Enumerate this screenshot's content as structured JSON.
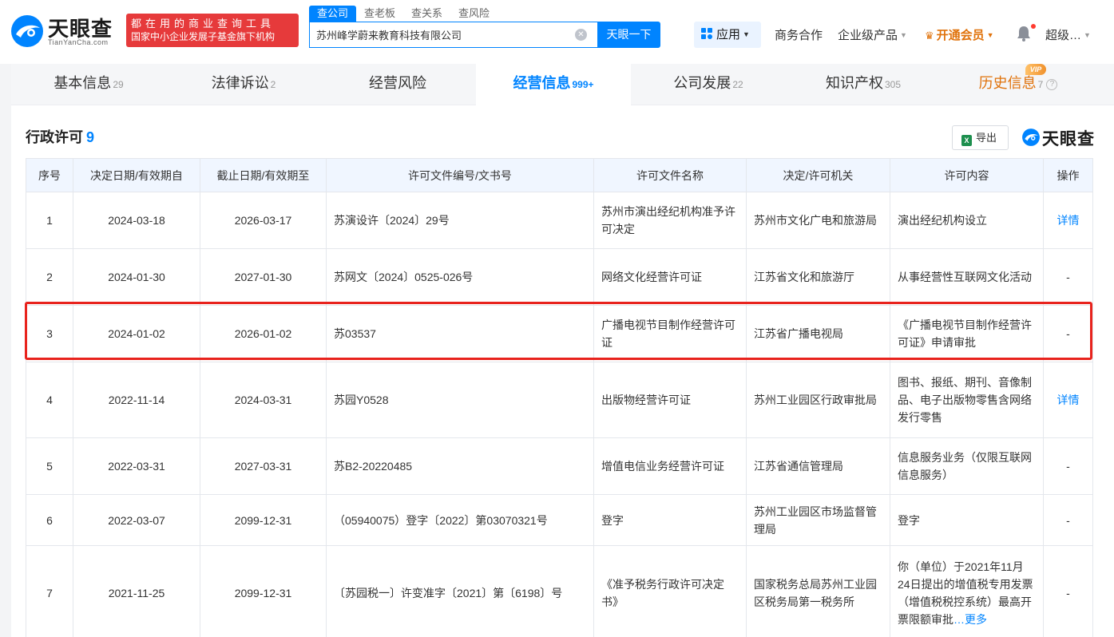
{
  "header": {
    "logo_text": "天眼查",
    "logo_sub": "TianYanCha.com",
    "slogan_line1": "都在用的商业查询工具",
    "slogan_line2": "国家中小企业发展子基金旗下机构",
    "search_tabs": [
      "查公司",
      "查老板",
      "查关系",
      "查风险"
    ],
    "search_value": "苏州峰学蔚来教育科技有限公司",
    "search_button": "天眼一下",
    "app_button": "应用",
    "nav": {
      "business": "商务合作",
      "enterprise": "企业级产品",
      "vip": "开通会员",
      "user": "超级…"
    }
  },
  "tabs": [
    {
      "label": "基本信息",
      "count": "29"
    },
    {
      "label": "法律诉讼",
      "count": "2"
    },
    {
      "label": "经营风险",
      "count": ""
    },
    {
      "label": "经营信息",
      "count": "999+"
    },
    {
      "label": "公司发展",
      "count": "22"
    },
    {
      "label": "知识产权",
      "count": "305"
    },
    {
      "label": "历史信息",
      "count": "7"
    }
  ],
  "vip_badge": "VIP",
  "section": {
    "title": "行政许可",
    "count": "9",
    "export_label": "导出",
    "brand": "天眼查"
  },
  "table": {
    "headers": [
      "序号",
      "决定日期/有效期自",
      "截止日期/有效期至",
      "许可文件编号/文书号",
      "许可文件名称",
      "决定/许可机关",
      "许可内容",
      "操作"
    ],
    "rows": [
      {
        "no": "1",
        "start": "2024-03-18",
        "end": "2026-03-17",
        "doc_no": "苏演设许〔2024〕29号",
        "doc_name": "苏州市演出经纪机构准予许可决定",
        "authority": "苏州市文化广电和旅游局",
        "content": "演出经纪机构设立",
        "action": "详情"
      },
      {
        "no": "2",
        "start": "2024-01-30",
        "end": "2027-01-30",
        "doc_no": "苏网文〔2024〕0525-026号",
        "doc_name": "网络文化经营许可证",
        "authority": "江苏省文化和旅游厅",
        "content": "从事经营性互联网文化活动",
        "action": "-"
      },
      {
        "no": "3",
        "start": "2024-01-02",
        "end": "2026-01-02",
        "doc_no": "苏03537",
        "doc_name": "广播电视节目制作经营许可证",
        "authority": "江苏省广播电视局",
        "content": "《广播电视节目制作经营许可证》申请审批",
        "action": "-"
      },
      {
        "no": "4",
        "start": "2022-11-14",
        "end": "2024-03-31",
        "doc_no": "苏园Y0528",
        "doc_name": "出版物经营许可证",
        "authority": "苏州工业园区行政审批局",
        "content": "图书、报纸、期刊、音像制品、电子出版物零售含网络发行零售",
        "action": "详情"
      },
      {
        "no": "5",
        "start": "2022-03-31",
        "end": "2027-03-31",
        "doc_no": "苏B2-20220485",
        "doc_name": "增值电信业务经营许可证",
        "authority": "江苏省通信管理局",
        "content": "信息服务业务（仅限互联网信息服务）",
        "action": "-"
      },
      {
        "no": "6",
        "start": "2022-03-07",
        "end": "2099-12-31",
        "doc_no": "（05940075）登字〔2022〕第03070321号",
        "doc_name": "登字",
        "authority": "苏州工业园区市场监督管理局",
        "content": "登字",
        "action": "-"
      },
      {
        "no": "7",
        "start": "2021-11-25",
        "end": "2099-12-31",
        "doc_no": "〔苏园税一〕许变准字〔2021〕第〔6198〕号",
        "doc_name": "《准予税务行政许可决定书》",
        "authority": "国家税务总局苏州工业园区税务局第一税务所",
        "content": "你（单位）于2021年11月24日提出的增值税专用发票（增值税税控系统）最高开票限额审批",
        "content_more": "…更多",
        "action": "-"
      }
    ]
  },
  "colors": {
    "accent": "#0084ff",
    "brand_red": "#e63a3b",
    "vip_orange": "#e0720b",
    "highlight": "#e8231d"
  }
}
